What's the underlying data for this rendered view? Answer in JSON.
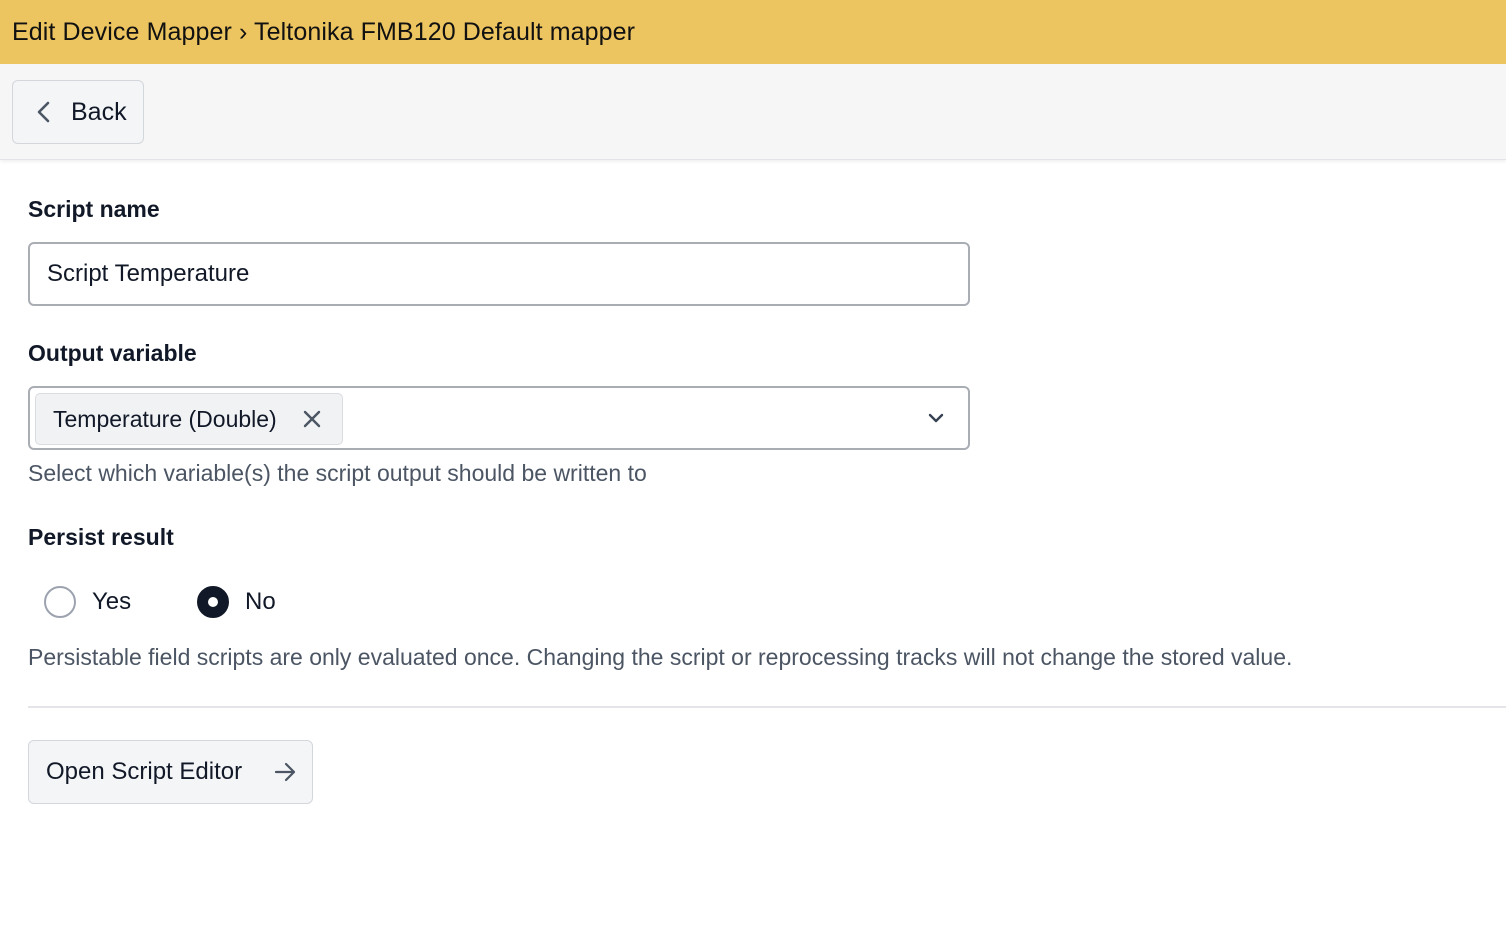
{
  "header": {
    "title": "Edit Device Mapper › Teltonika FMB120 Default mapper",
    "background": "#ecc460"
  },
  "toolbar": {
    "back_label": "Back",
    "back_icon": "chevron-left-icon"
  },
  "form": {
    "script_name": {
      "label": "Script name",
      "value": "Script Temperature"
    },
    "output_variable": {
      "label": "Output variable",
      "selected": [
        "Temperature (Double)"
      ],
      "remove_icon": "close-icon",
      "dropdown_icon": "chevron-down-icon",
      "help": "Select which variable(s) the script output should be written to"
    },
    "persist_result": {
      "label": "Persist result",
      "options": [
        {
          "label": "Yes",
          "selected": false
        },
        {
          "label": "No",
          "selected": true
        }
      ],
      "help": "Persistable field scripts are only evaluated once. Changing the script or reprocessing tracks will not change the stored value."
    },
    "open_editor": {
      "label": "Open Script Editor",
      "icon": "arrow-right-icon"
    }
  }
}
